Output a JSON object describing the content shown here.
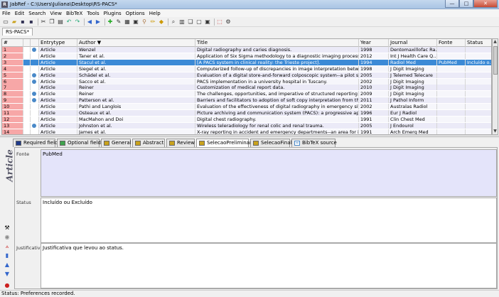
{
  "window": {
    "title": "JabRef - C:\\Users\\Juliana\\Desktop\\RS-PACS*",
    "app_icon_letter": "R",
    "minimize": "—",
    "maximize": "□",
    "close": "✕"
  },
  "menu": [
    "File",
    "Edit",
    "Search",
    "View",
    "BibTeX",
    "Tools",
    "Plugins",
    "Options",
    "Help"
  ],
  "toolbar_icons": [
    "new-icon",
    "open-icon",
    "save-icon",
    "save-all-icon",
    "cut-icon",
    "copy-icon",
    "paste-icon",
    "undo-icon",
    "redo-icon",
    "back-icon",
    "forward-icon",
    "add-entry-icon",
    "edit-entry-icon",
    "push-icon",
    "preview-icon",
    "wand-icon",
    "pen-icon",
    "mark-icon",
    "search-icon",
    "toggle-groups-icon",
    "duplicate-icon",
    "open-pdf-icon",
    "open-url-icon",
    "latex-icon",
    "options-icon"
  ],
  "database_tab": "RS-PACS*",
  "table": {
    "headers": {
      "num": "#",
      "entrytype": "Entrytype",
      "author": "Author ▼",
      "title": "Title",
      "year": "Year",
      "journal": "Journal",
      "fonte": "Fonte",
      "status": "Status"
    },
    "rows": [
      {
        "num": "1",
        "icon": true,
        "type": "Article",
        "author": "Wenzel",
        "title": "Digital radiography and caries diagnosis.",
        "year": "1998",
        "journal": "Dentomaxillofac Ra...",
        "fonte": "",
        "status": ""
      },
      {
        "num": "2",
        "icon": false,
        "type": "Article",
        "author": "Taner et al.",
        "title": "Application of Six Sigma methodology to a diagnostic imaging process.",
        "year": "2012",
        "journal": "Int J Health Care Q...",
        "fonte": "",
        "status": ""
      },
      {
        "num": "3",
        "icon": false,
        "type": "Article",
        "author": "Stacul et al.",
        "title": "[A PACS system in clinical reality: the Trieste project].",
        "year": "1994",
        "journal": "Radiol Med",
        "fonte": "PubMed",
        "status": "Incluído o...",
        "selected": true
      },
      {
        "num": "4",
        "icon": false,
        "type": "Article",
        "author": "Siegel et al.",
        "title": "Computerized follow-up of discrepancies in image interpretation between e...",
        "year": "1998",
        "journal": "J Digit Imaging",
        "fonte": "",
        "status": ""
      },
      {
        "num": "5",
        "icon": true,
        "type": "Article",
        "author": "Schädel et al.",
        "title": "Evaluation of a digital store-and-forward colposcopic system--a pilot study t...",
        "year": "2005",
        "journal": "J Telemed Telecare",
        "fonte": "",
        "status": ""
      },
      {
        "num": "6",
        "icon": true,
        "type": "Article",
        "author": "Sacco et al.",
        "title": "PACS implementation in a university hospital in Tuscany.",
        "year": "2002",
        "journal": "J Digit Imaging",
        "fonte": "",
        "status": ""
      },
      {
        "num": "7",
        "icon": false,
        "type": "Article",
        "author": "Reiner",
        "title": "Customization of medical report data.",
        "year": "2010",
        "journal": "J Digit Imaging",
        "fonte": "",
        "status": ""
      },
      {
        "num": "8",
        "icon": true,
        "type": "Article",
        "author": "Reiner",
        "title": "The challenges, opportunities, and imperative of structured reporting in me...",
        "year": "2009",
        "journal": "J Digit Imaging",
        "fonte": "",
        "status": ""
      },
      {
        "num": "9",
        "icon": true,
        "type": "Article",
        "author": "Patterson et al.",
        "title": "Barriers and facilitators to adoption of soft copy interpretation from the user...",
        "year": "2011",
        "journal": "J Pathol Inform",
        "fonte": "",
        "status": ""
      },
      {
        "num": "10",
        "icon": false,
        "type": "Article",
        "author": "Pathi and Langlois",
        "title": "Evaluation of the effectiveness of digital radiography in emergency situations.",
        "year": "2002",
        "journal": "Australas Radiol",
        "fonte": "",
        "status": ""
      },
      {
        "num": "11",
        "icon": false,
        "type": "Article",
        "author": "Osteaux et al.",
        "title": "Picture archiving and communication system (PACS): a progressive appro...",
        "year": "1996",
        "journal": "Eur J Radiol",
        "fonte": "",
        "status": ""
      },
      {
        "num": "12",
        "icon": false,
        "type": "Article",
        "author": "MacMahon and Doi",
        "title": "Digital chest radiography.",
        "year": "1991",
        "journal": "Clin Chest Med",
        "fonte": "",
        "status": ""
      },
      {
        "num": "13",
        "icon": true,
        "type": "Article",
        "author": "Johnston et al.",
        "title": "Wireless teleradiology for renal colic and renal trauma.",
        "year": "2005",
        "journal": "J Endourol",
        "fonte": "",
        "status": ""
      },
      {
        "num": "14",
        "icon": false,
        "type": "Article",
        "author": "James et al.",
        "title": "X-ray reporting in accident and emergency departments--an area for improv...",
        "year": "1991",
        "journal": "Arch Emerg Med",
        "fonte": "",
        "status": ""
      }
    ]
  },
  "editor_tabs": [
    {
      "label": "Required fields",
      "color": "#1f3a8a"
    },
    {
      "label": "Optional fields",
      "color": "#3fa34d"
    },
    {
      "label": "General",
      "color": "#c9a21d"
    },
    {
      "label": "Abstract",
      "color": "#c9a21d"
    },
    {
      "label": "Review",
      "color": "#c9a21d"
    },
    {
      "label": "SelecaoPreliminar",
      "color": "#c9a21d",
      "active": true
    },
    {
      "label": "SelecaoFinal",
      "color": "#c9a21d"
    },
    {
      "label": "BibTeX source",
      "color": "#4a89c8"
    }
  ],
  "entry_label": "Article",
  "fields": {
    "fonte_label": "Fonte",
    "fonte_value": "PubMed",
    "status_label": "Status",
    "status_value": "Incluído ou Excluído",
    "justificativa_label": "Justificativa",
    "justificativa_value": "Justificativa que levou ao status."
  },
  "colors": {
    "selection": "#3c8ad6",
    "row_number": "#f7a7a7",
    "fonte_bg": "#e4e4fa"
  },
  "status_bar": "Status: Preferences recorded."
}
